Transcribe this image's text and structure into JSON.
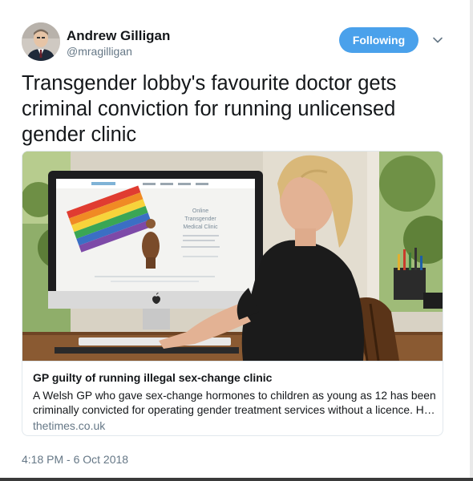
{
  "author": {
    "name": "Andrew Gilligan",
    "handle": "@mragilligan"
  },
  "follow_button": {
    "label": "Following"
  },
  "tweet": {
    "lines": [
      "Transgender lobby's favourite doctor gets",
      "criminal conviction for running unlicensed",
      "gender clinic"
    ],
    "timestamp": "4:18 PM - 6 Oct 2018"
  },
  "card": {
    "screen_text": {
      "clinic_name_1": "Online",
      "clinic_name_2": "Transgender",
      "clinic_name_3": "Medical Clinic"
    },
    "title": "GP guilty of running illegal sex-change clinic",
    "description_lines": [
      "A Welsh GP who gave sex-change hormones to children as young as 12 has been",
      "criminally convicted for operating gender treatment services without a licence. He..."
    ],
    "domain": "thetimes.co.uk"
  },
  "colors": {
    "accent": "#4aa1eb",
    "text": "#14171a",
    "muted": "#657786",
    "border": "#e1e8ed"
  },
  "icons": {
    "caret": "chevron-down-icon",
    "apple": "apple-logo-icon"
  }
}
